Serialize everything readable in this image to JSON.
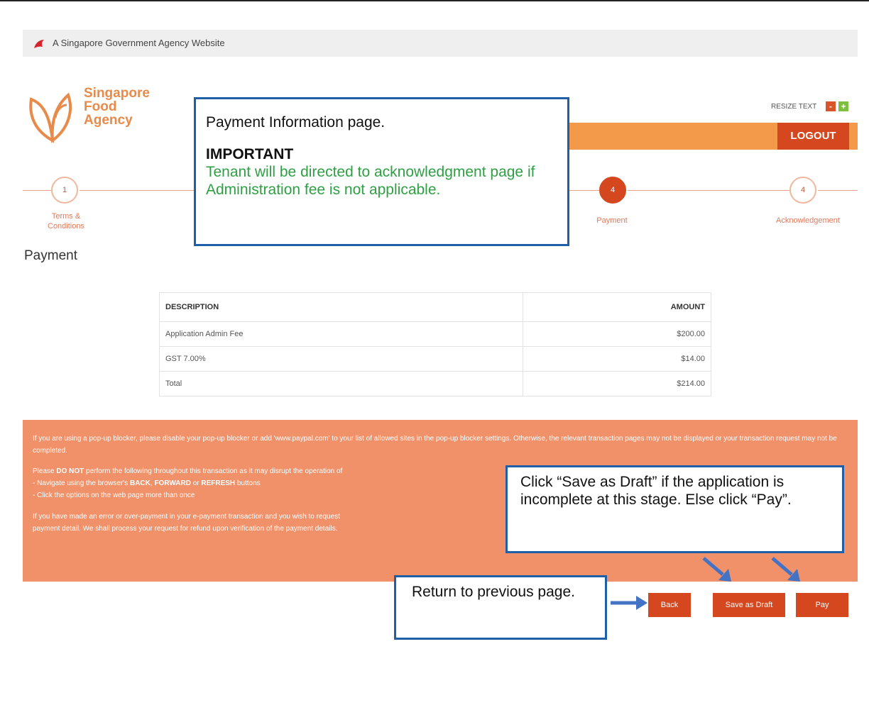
{
  "gov_banner": {
    "text": "A Singapore Government Agency Website"
  },
  "logo": {
    "line1": "Singapore",
    "line2": "Food",
    "line3": "Agency"
  },
  "header": {
    "resize_label": "RESIZE TEXT",
    "decrease_label": "-",
    "increase_label": "+",
    "logout_label": "LOGOUT"
  },
  "steps": [
    {
      "number": "1",
      "label_line1": "Terms &",
      "label_line2": "Conditions"
    },
    {
      "number": "4",
      "label_line1": "Payment",
      "label_line2": ""
    },
    {
      "number": "4",
      "label_line1": "Acknowledgement",
      "label_line2": ""
    }
  ],
  "page_title": "Payment",
  "table": {
    "headers": {
      "description": "DESCRIPTION",
      "amount": "AMOUNT"
    },
    "rows": [
      {
        "description": "Application Admin Fee",
        "amount": "$200.00"
      },
      {
        "description": "GST 7.00%",
        "amount": "$14.00"
      },
      {
        "description": "Total",
        "amount": "$214.00"
      }
    ]
  },
  "notice": {
    "p1": "If you are using a pop-up blocker, please disable your pop-up blocker or add 'www.paypal.com' to your list of allowed sites in the pop-up blocker settings. Otherwise, the relevant transaction pages may not be displayed or your transaction request may not be completed.",
    "p2_intro": "Please ",
    "p2_bold": "DO NOT",
    "p2_rest": " perform the following throughout this transaction as it may disrupt the operation of",
    "p2_bullet1_pre": "- Navigate using the browser's ",
    "p2_bullet1_bold1": "BACK",
    "p2_bullet1_sep": ", ",
    "p2_bullet1_bold2": "FORWARD",
    "p2_bullet1_or": " or ",
    "p2_bullet1_bold3": "REFRESH",
    "p2_bullet1_post": " buttons",
    "p2_bullet2": "- Click the options on the web page more than once",
    "p3": "If you have made an error or over-payment in your e-payment transaction and you wish to request",
    "p3b": "payment detail. We shall process your request for refund upon verification of the payment details."
  },
  "actions": {
    "back": "Back",
    "save_draft": "Save as Draft",
    "pay": "Pay"
  },
  "callouts": {
    "top": {
      "line1": "Payment Information page.",
      "important": "IMPORTANT",
      "green": "Tenant will be directed to acknowledgment page if Administration fee is not applicable."
    },
    "right": "Click “Save as Draft” if the application is incomplete at this stage. Else click “Pay”.",
    "bottom": "Return to previous page."
  },
  "colors": {
    "brand_orange": "#f29a4a",
    "accent_red": "#d4471f",
    "notice_bg": "#f0916a",
    "callout_border": "#1f5fa8",
    "callout_green": "#2ea043"
  }
}
